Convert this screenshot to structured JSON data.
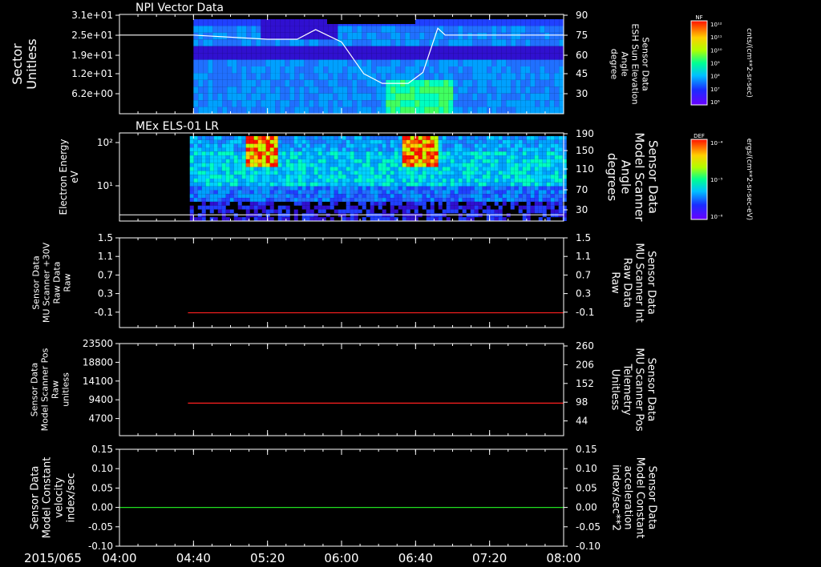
{
  "time_axis": {
    "date_label": "2015/065",
    "ticks": [
      "04:00",
      "04:40",
      "05:20",
      "06:00",
      "06:40",
      "07:20",
      "08:00"
    ]
  },
  "panels": [
    {
      "id": "sector",
      "title": "NPI Vector Data",
      "left_label": [
        "Sector",
        "Unitless"
      ],
      "left_ticks": [
        "3.1e+01",
        "2.5e+01",
        "1.9e+01",
        "1.2e+01",
        "6.2e+00"
      ],
      "right_label": [
        "Sensor Data",
        "ESH Sun Elevation",
        "Angle",
        "degree"
      ],
      "right_label_color": "#ffffff",
      "right_ticks": [
        "90",
        "75",
        "60",
        "45",
        "30"
      ],
      "colorbar": {
        "title": "NF",
        "unit": "cnts/(cm**2-sr-sec)",
        "ticks": [
          "10¹²",
          "10¹¹",
          "10¹⁰",
          "10⁹",
          "10⁸",
          "10⁷",
          "10⁶"
        ]
      }
    },
    {
      "id": "els",
      "title": "MEx ELS-01 LR",
      "left_label": [
        "Electron Energy",
        "eV"
      ],
      "left_ticks": [
        "10²",
        "10¹"
      ],
      "right_label": [
        "Sensor Data",
        "Model Scanner",
        "Angle",
        "degrees"
      ],
      "right_label_color": "#ffffff",
      "right_ticks": [
        "190",
        "150",
        "110",
        "70",
        "30"
      ],
      "colorbar": {
        "title": "DEF",
        "unit": "ergs/(cm**2-sr-sec-eV)",
        "ticks": [
          "10⁻⁴",
          "10⁻⁵",
          "10⁻⁶"
        ]
      }
    },
    {
      "id": "raw",
      "left_label": [
        "Sensor Data",
        "MU Scanner +30V",
        "Raw Data",
        "Raw"
      ],
      "left_ticks": [
        "1.5",
        "1.1",
        "0.7",
        "0.3",
        "-0.1"
      ],
      "right_label": [
        "Sensor Data",
        "MU Scanner Int",
        "Raw Data",
        "Raw"
      ],
      "right_label_color": "#ff2020",
      "right_ticks": [
        "1.5",
        "1.1",
        "0.7",
        "0.3",
        "-0.1"
      ]
    },
    {
      "id": "pos",
      "left_label": [
        "Sensor Data",
        "Model Scanner Pos",
        "Raw",
        "unitless"
      ],
      "left_ticks": [
        "23500",
        "18800",
        "14100",
        "9400",
        "4700"
      ],
      "right_label": [
        "Sensor Data",
        "MU Scanner Pos",
        "Telemetry",
        "Unitless"
      ],
      "right_label_color": "#ff2020",
      "right_ticks": [
        "260",
        "206",
        "152",
        "98",
        "44"
      ]
    },
    {
      "id": "vel",
      "left_label": [
        "Sensor Data",
        "Model Constant",
        "velocity",
        "index/sec"
      ],
      "left_ticks": [
        "0.15",
        "0.10",
        "0.05",
        "0.00",
        "-0.05",
        "-0.10"
      ],
      "right_label": [
        "Sensor Data",
        "Model Constant",
        "acceleration",
        "index/sec**2"
      ],
      "right_label_color": "#20e020",
      "right_ticks": [
        "0.15",
        "0.10",
        "0.05",
        "0.00",
        "-0.05",
        "-0.10"
      ]
    }
  ],
  "chart_data": [
    {
      "type": "heatmap",
      "title": "NPI Vector Data",
      "ylabel": "Sector Unitless",
      "y2label": "Sensor Data ESH Sun Elevation Angle degree",
      "x_range": [
        "04:00",
        "08:00"
      ],
      "data_start": "04:40",
      "line_series": {
        "name": "ESH Sun Elevation Angle",
        "x": [
          "04:00",
          "04:40",
          "05:20",
          "05:36",
          "05:46",
          "06:00",
          "06:12",
          "06:22",
          "06:36",
          "06:44",
          "06:52",
          "06:56",
          "08:00"
        ],
        "y": [
          75,
          75,
          72,
          72,
          79,
          70,
          47,
          40,
          40,
          48,
          80,
          75,
          75
        ],
        "ylim": [
          18,
          90
        ]
      }
    },
    {
      "type": "heatmap",
      "title": "MEx ELS-01 LR",
      "ylabel": "Electron Energy eV",
      "y2label": "Sensor Data Model Scanner Angle degrees",
      "x_range": [
        "04:00",
        "08:00"
      ],
      "data_start": "04:40",
      "line_series": {
        "name": "Model Scanner Angle",
        "x": [
          "04:00",
          "08:00"
        ],
        "y": [
          18,
          18
        ],
        "ylim": [
          5,
          190
        ]
      }
    },
    {
      "type": "line",
      "ylabel": "Sensor Data MU Scanner +30V Raw Data Raw",
      "y2label": "Sensor Data MU Scanner Int Raw Data Raw",
      "ylim": [
        -0.32,
        1.5
      ],
      "series": [
        {
          "name": "MU Scanner Int Raw Data",
          "color": "#ff2020",
          "x": [
            "04:37",
            "08:00"
          ],
          "y": [
            -0.02,
            -0.02
          ]
        }
      ]
    },
    {
      "type": "line",
      "ylabel": "Sensor Data Model Scanner Pos Raw unitless",
      "y2label": "Sensor Data MU Scanner Pos Telemetry Unitless",
      "ylim": [
        0,
        23500
      ],
      "series": [
        {
          "name": "MU Scanner Pos Telemetry",
          "color": "#ff2020",
          "x": [
            "04:37",
            "08:00"
          ],
          "y": [
            8300,
            8300
          ]
        }
      ]
    },
    {
      "type": "line",
      "ylabel": "Sensor Data Model Constant velocity index/sec",
      "y2label": "Sensor Data Model Constant acceleration index/sec**2",
      "ylim": [
        -0.1,
        0.15
      ],
      "series": [
        {
          "name": "Model Constant acceleration",
          "color": "#20e020",
          "x": [
            "04:00",
            "08:00"
          ],
          "y": [
            0.0,
            0.0
          ]
        }
      ]
    }
  ]
}
